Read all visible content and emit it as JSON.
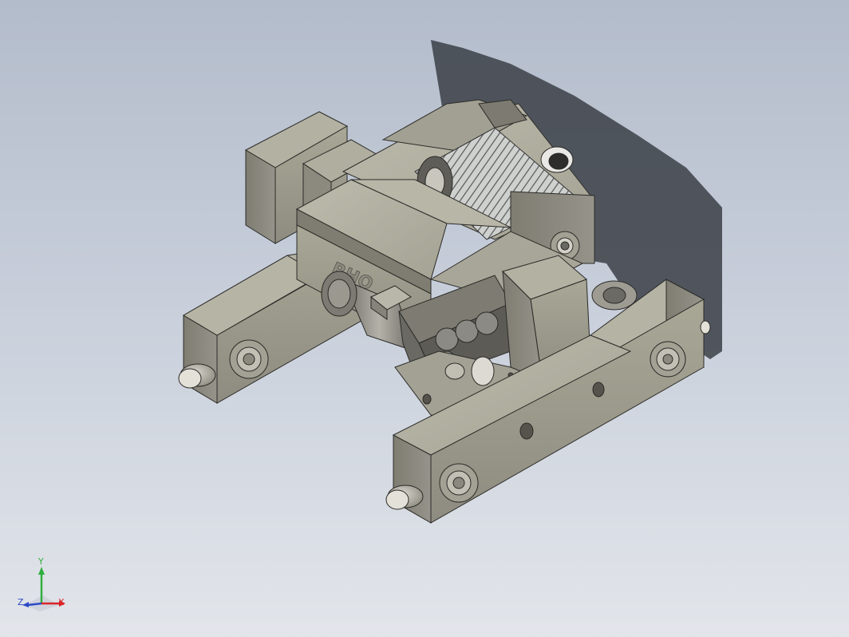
{
  "viewport": {
    "background_top": "#b3bccb",
    "background_bottom": "#e2e5ea"
  },
  "model": {
    "brand_text": "RHO",
    "body_color": "#a9a796",
    "body_dark": "#86847a",
    "shadow_color": "#3b3f46"
  },
  "triad": {
    "x_label": "X",
    "y_label": "Y",
    "z_label": "Z",
    "x_color": "#d9242a",
    "y_color": "#2fae3f",
    "z_color": "#2e49c7"
  }
}
